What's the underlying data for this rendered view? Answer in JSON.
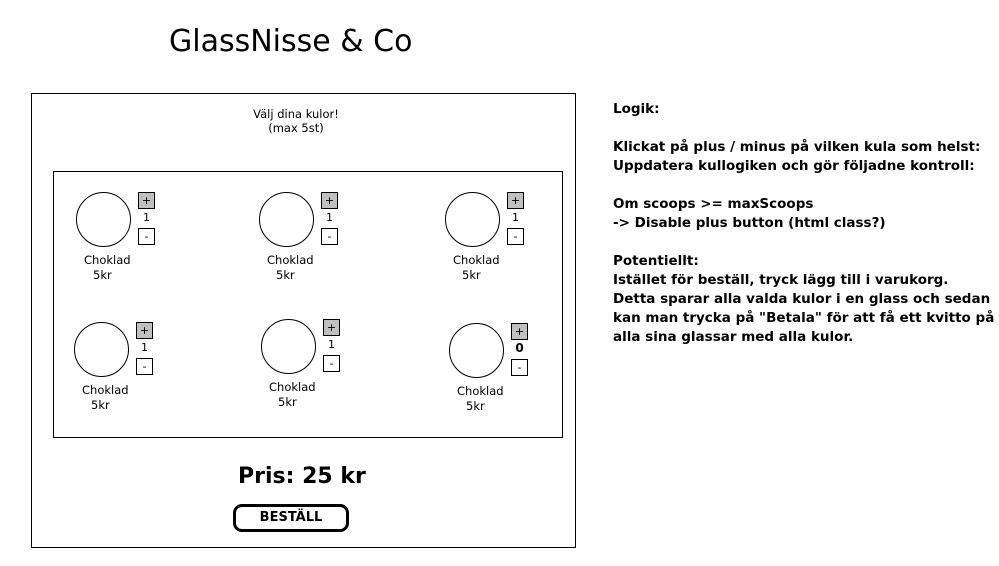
{
  "header": {
    "title": "GlassNisse & Co"
  },
  "picker": {
    "subtitle_line1": "Välj dina kulor!",
    "subtitle_line2": "(max 5st)",
    "plus_label": "+",
    "minus_label": "-",
    "scoops": [
      {
        "name": "Choklad",
        "price": "5kr",
        "count": "1"
      },
      {
        "name": "Choklad",
        "price": "5kr",
        "count": "1"
      },
      {
        "name": "Choklad",
        "price": "5kr",
        "count": "1"
      },
      {
        "name": "Choklad",
        "price": "5kr",
        "count": "1"
      },
      {
        "name": "Choklad",
        "price": "5kr",
        "count": "1"
      },
      {
        "name": "Choklad",
        "price": "5kr",
        "count": "0"
      }
    ]
  },
  "footer": {
    "total": "Pris: 25 kr",
    "order_label": "BESTÄLL"
  },
  "notes": {
    "lines": [
      "Logik:",
      "",
      "Klickat på plus / minus på vilken kula som helst:",
      "Uppdatera kullogiken och gör följadne kontroll:",
      "",
      "Om scoops >= maxScoops",
      "-> Disable plus button (html class?)",
      "",
      "Potentiellt:",
      "Istället för beställ, tryck lägg till i varukorg.",
      "Detta sparar alla valda kulor i en glass och sedan",
      "kan man trycka på \"Betala\" för att få ett kvitto på",
      "alla sina glassar med alla kulor."
    ]
  }
}
